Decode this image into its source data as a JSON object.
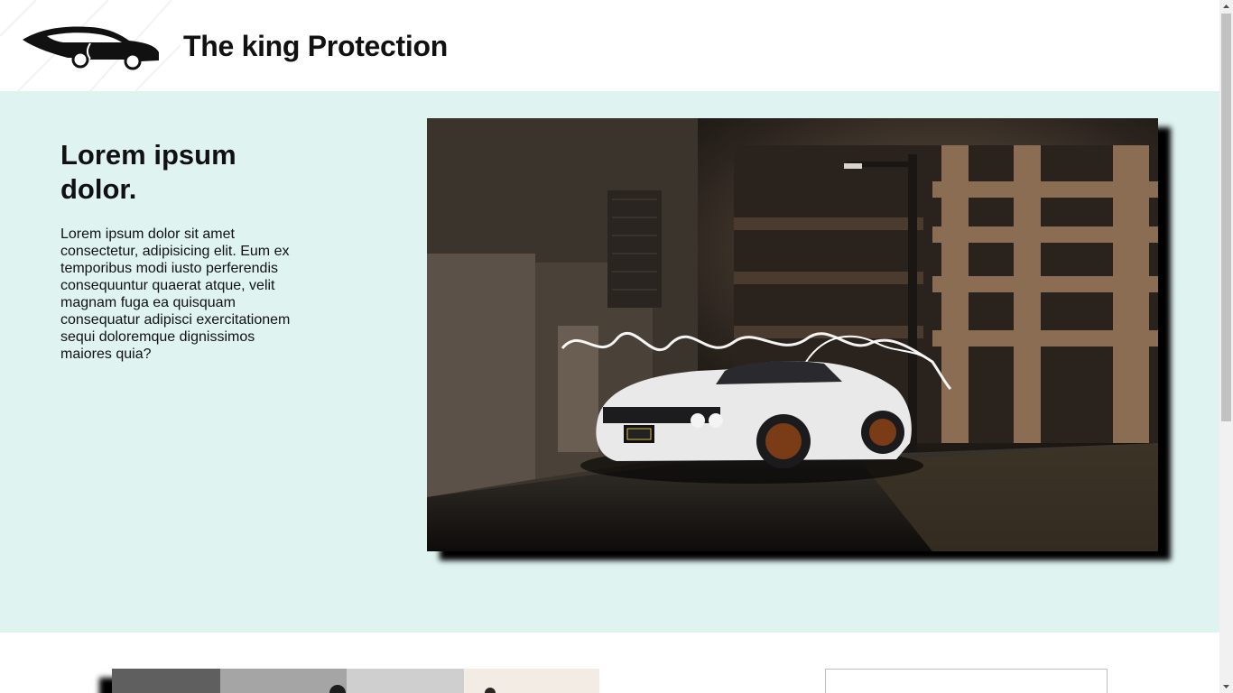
{
  "header": {
    "logo_icon": "car-silhouette-logo",
    "site_title": "The king Protection"
  },
  "hero": {
    "heading": "Lorem ipsum dolor.",
    "body": "Lorem ipsum dolor sit amet consectetur, adipisicing elit. Eum ex temporibus modi iusto perferendis consequuntur quaerat atque, velit magnam fuga ea quisquam consequatur adipisci exercitationem sequi doloremque dignissimos maiores quia?",
    "image": {
      "subject": "white muscle car parked at night with light painting",
      "license_plate": "YETI_14"
    }
  },
  "colors": {
    "hero_background": "#dff3f1",
    "page_background": "#ffffff",
    "text": "#111111"
  },
  "scrollbar": {
    "up_icon": "scroll-up-arrow-icon",
    "down_icon": "scroll-down-arrow-icon"
  }
}
